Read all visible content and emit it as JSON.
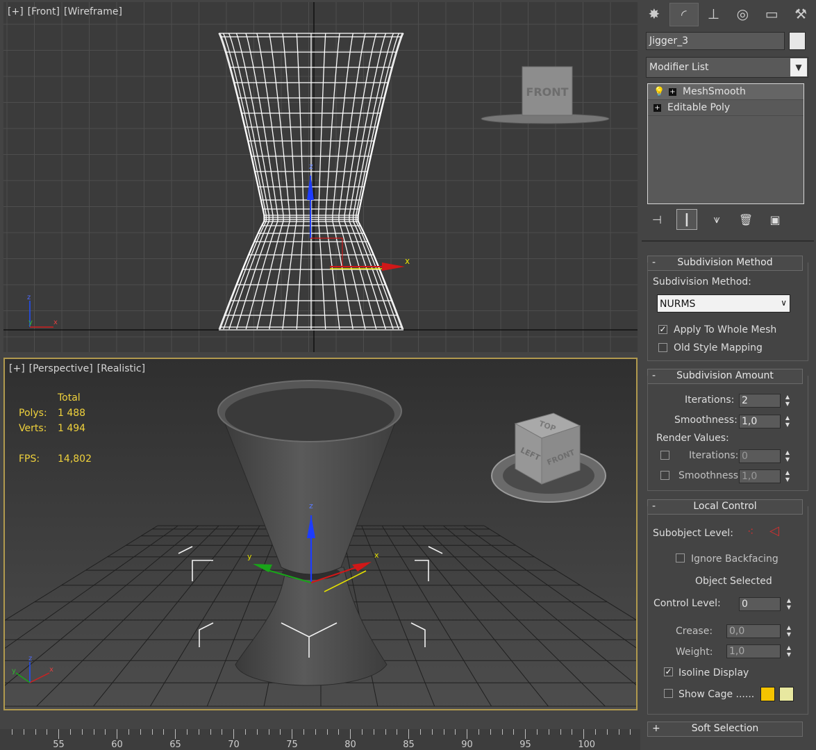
{
  "front_viewport": {
    "label": [
      "[+]",
      "[Front]",
      "[Wireframe]"
    ],
    "viewcube_face": "FRONT",
    "gizmo_x": "x",
    "gizmo_z": "z",
    "corner_axis_z": "z",
    "corner_axis_y": "y",
    "corner_axis_x": "x"
  },
  "persp_viewport": {
    "label": [
      "[+]",
      "[Perspective]",
      "[Realistic]"
    ],
    "stats": {
      "header": "Total",
      "polys_label": "Polys:",
      "polys_value": "1 488",
      "verts_label": "Verts:",
      "verts_value": "1 494",
      "fps_label": "FPS:",
      "fps_value": "14,802"
    },
    "viewcube": {
      "top": "TOP",
      "left": "LEFT",
      "front": "FRONT"
    },
    "gizmo_x": "x",
    "gizmo_y": "y",
    "gizmo_z": "z",
    "corner_axis_z": "z",
    "corner_axis_y": "y",
    "corner_axis_x": "x",
    "border_color": "#b19a4e"
  },
  "command_panel": {
    "tabs": [
      {
        "icon": "create-icon",
        "glyph": "✸"
      },
      {
        "icon": "modify-icon",
        "glyph": "◜"
      },
      {
        "icon": "hierarchy-icon",
        "glyph": "⊥"
      },
      {
        "icon": "motion-icon",
        "glyph": "◎"
      },
      {
        "icon": "display-icon",
        "glyph": "▭"
      },
      {
        "icon": "utilities-icon",
        "glyph": "⚒"
      }
    ],
    "object_name": "Jigger_3",
    "object_color": "#e7e7e7",
    "modifier_list": "Modifier List",
    "stack": [
      {
        "label": "MeshSmooth",
        "selected": true
      },
      {
        "label": "Editable Poly",
        "selected": false
      }
    ],
    "subdivision_method": {
      "title": "Subdivision Method",
      "method_label": "Subdivision Method:",
      "method_value": "NURMS",
      "apply_whole_mesh": "Apply To Whole Mesh",
      "apply_whole_mesh_checked": true,
      "old_style_mapping": "Old Style Mapping",
      "old_style_mapping_checked": false
    },
    "subdivision_amount": {
      "title": "Subdivision Amount",
      "iterations_label": "Iterations:",
      "iterations_value": "2",
      "smoothness_label": "Smoothness:",
      "smoothness_value": "1,0",
      "render_values": "Render Values:",
      "render_iterations_label": "Iterations:",
      "render_iterations_value": "0",
      "render_smoothness_label": "Smoothness:",
      "render_smoothness_value": "1,0"
    },
    "local_control": {
      "title": "Local Control",
      "subobject_label": "Subobject Level:",
      "ignore_backfacing": "Ignore Backfacing",
      "object_selected": "Object Selected",
      "control_level_label": "Control Level:",
      "control_level_value": "0",
      "crease_label": "Crease:",
      "crease_value": "0,0",
      "weight_label": "Weight:",
      "weight_value": "1,0",
      "isoline_display": "Isoline Display",
      "isoline_checked": true,
      "show_cage": "Show Cage ......",
      "cage_color_1": "#f5c400",
      "cage_color_2": "#e8e8a0"
    },
    "soft_selection": {
      "title": "Soft Selection",
      "sign": "+"
    }
  },
  "timeline": {
    "labels": [
      "55",
      "60",
      "65",
      "70",
      "75",
      "80",
      "85",
      "90",
      "95",
      "100"
    ]
  }
}
